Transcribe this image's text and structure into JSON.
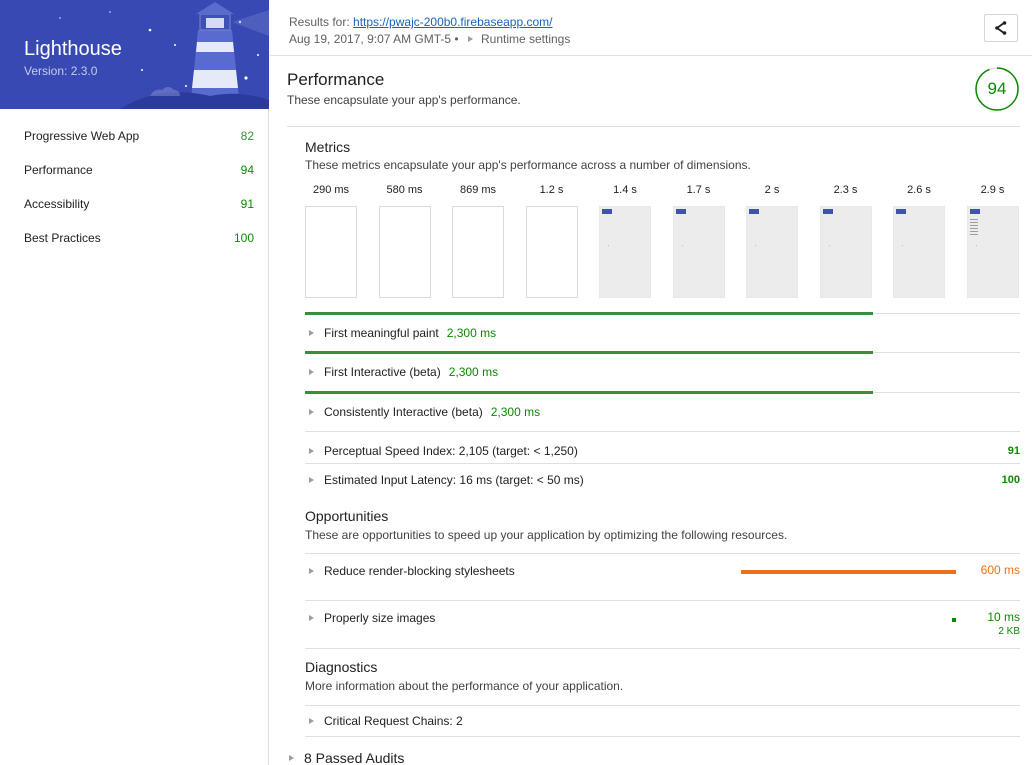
{
  "sidebar": {
    "app_title": "Lighthouse",
    "version": "Version: 2.3.0",
    "items": [
      {
        "label": "Progressive Web App",
        "score": "82"
      },
      {
        "label": "Performance",
        "score": "94"
      },
      {
        "label": "Accessibility",
        "score": "91"
      },
      {
        "label": "Best Practices",
        "score": "100"
      }
    ]
  },
  "header": {
    "results_prefix": "Results for: ",
    "url": "https://pwajc-200b0.firebaseapp.com/",
    "timestamp": "Aug 19, 2017, 9:07 AM GMT-5 •",
    "runtime_settings": "Runtime settings"
  },
  "category": {
    "title": "Performance",
    "description": "These encapsulate your app's performance.",
    "score": "94",
    "score_fraction": 0.94
  },
  "metrics": {
    "title": "Metrics",
    "description": "These metrics encapsulate your app's performance across a number of dimensions.",
    "filmstrip_times": [
      "290 ms",
      "580 ms",
      "869 ms",
      "1.2 s",
      "1.4 s",
      "1.7 s",
      "2 s",
      "2.3 s",
      "2.6 s",
      "2.9 s"
    ],
    "filmstrip_painted": [
      false,
      false,
      false,
      false,
      true,
      true,
      true,
      true,
      true,
      true
    ],
    "audits": [
      {
        "label": "First meaningful paint",
        "value": "2,300 ms",
        "score": ""
      },
      {
        "label": "First Interactive (beta)",
        "value": "2,300 ms",
        "score": ""
      },
      {
        "label": "Consistently Interactive (beta)",
        "value": "2,300 ms",
        "score": ""
      },
      {
        "label": "Perceptual Speed Index: 2,105 (target: < 1,250)",
        "value": "",
        "score": "91"
      },
      {
        "label": "Estimated Input Latency: 16 ms (target: < 50 ms)",
        "value": "",
        "score": "100"
      }
    ]
  },
  "opportunities": {
    "title": "Opportunities",
    "description": "These are opportunities to speed up your application by optimizing the following resources.",
    "items": [
      {
        "label": "Reduce render-blocking stylesheets",
        "value": "600 ms",
        "sub": "",
        "color": "#e8711a",
        "fraction": 1.0
      },
      {
        "label": "Properly size images",
        "value": "10 ms",
        "sub": "2 KB",
        "color": "#0b8a00",
        "fraction": 0.017
      }
    ]
  },
  "diagnostics": {
    "title": "Diagnostics",
    "description": "More information about the performance of your application.",
    "items": [
      {
        "label": "Critical Request Chains: 2"
      }
    ]
  },
  "passed_audits": "8 Passed Audits",
  "colors": {
    "brand": "#3849b4",
    "pass": "#0b8a00",
    "average": "#e8711a"
  },
  "icons": [
    "share-icon",
    "expand-triangle-icon",
    "lighthouse-logo"
  ]
}
